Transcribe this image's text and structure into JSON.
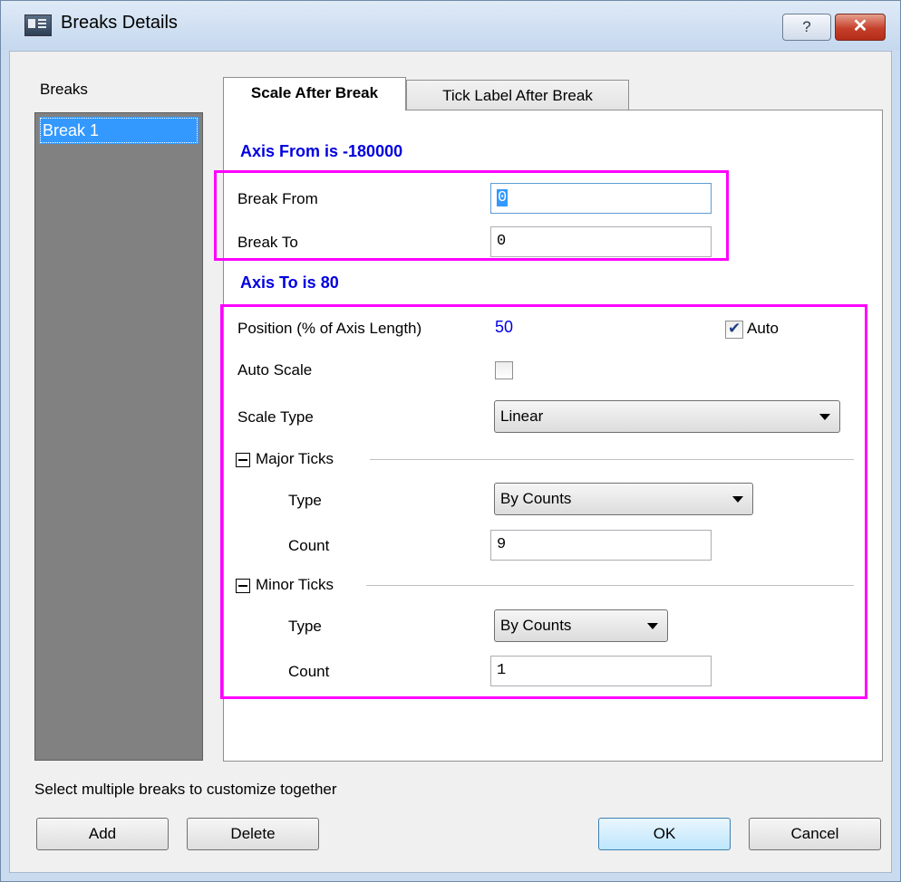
{
  "window": {
    "title": "Breaks Details",
    "help_label": "?",
    "close_label": "✕"
  },
  "breaks": {
    "label": "Breaks",
    "items": [
      "Break 1"
    ]
  },
  "tabs": [
    {
      "label": "Scale After Break"
    },
    {
      "label": "Tick Label After Break"
    }
  ],
  "scale": {
    "axis_from": "Axis From is -180000",
    "break_from": {
      "label": "Break From",
      "value": "0"
    },
    "break_to": {
      "label": "Break To",
      "value": "0"
    },
    "axis_to": "Axis To is 80",
    "position": {
      "label": "Position (% of Axis Length)",
      "value": "50",
      "auto_label": "Auto",
      "auto_checked": true
    },
    "auto_scale": {
      "label": "Auto Scale",
      "checked": false
    },
    "scale_type": {
      "label": "Scale Type",
      "value": "Linear"
    },
    "major_ticks": {
      "title": "Major Ticks",
      "type_label": "Type",
      "type_value": "By Counts",
      "count_label": "Count",
      "count_value": "9"
    },
    "minor_ticks": {
      "title": "Minor Ticks",
      "type_label": "Type",
      "type_value": "By Counts",
      "count_label": "Count",
      "count_value": "1"
    }
  },
  "footer": {
    "note": "Select multiple breaks to customize together",
    "add": "Add",
    "delete": "Delete",
    "ok": "OK",
    "cancel": "Cancel"
  },
  "colors": {
    "highlight_box": "#ff00ff",
    "heading_blue": "#0000e0",
    "selection": "#3399ff"
  }
}
